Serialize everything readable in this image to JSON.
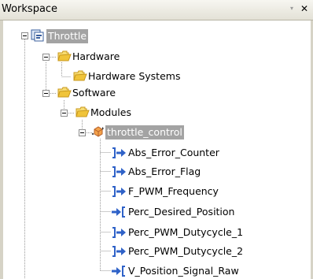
{
  "panel": {
    "title": "Workspace",
    "dropdown_glyph": "▾",
    "close_glyph": "✕"
  },
  "tree": {
    "root": {
      "label": "Throttle",
      "icon": "project-icon"
    },
    "hardware": {
      "label": "Hardware",
      "icon": "folder-icon"
    },
    "hardware_systems": {
      "label": "Hardware Systems",
      "icon": "folder-icon"
    },
    "software": {
      "label": "Software",
      "icon": "folder-icon"
    },
    "modules": {
      "label": "Modules",
      "icon": "folder-icon"
    },
    "throttle_control": {
      "label": "throttle_control",
      "icon": "module-icon"
    },
    "signals": [
      {
        "label": "Abs_Error_Counter",
        "direction": "output"
      },
      {
        "label": "Abs_Error_Flag",
        "direction": "output"
      },
      {
        "label": "F_PWM_Frequency",
        "direction": "output"
      },
      {
        "label": "Perc_Desired_Position",
        "direction": "input"
      },
      {
        "label": "Perc_PWM_Dutycycle_1",
        "direction": "output"
      },
      {
        "label": "Perc_PWM_Dutycycle_2",
        "direction": "output"
      },
      {
        "label": "V_Position_Signal_Raw",
        "direction": "input"
      }
    ]
  },
  "colors": {
    "selection": "#a3a3a3",
    "folder": "#f0c43a",
    "signal_arrow": "#2f62c8"
  }
}
